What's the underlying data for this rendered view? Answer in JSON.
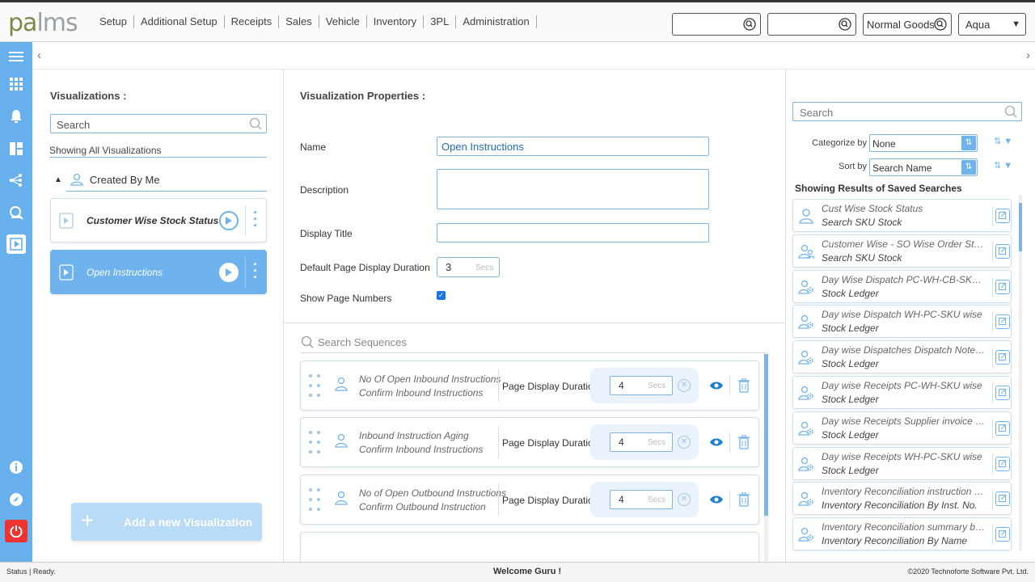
{
  "app": {
    "logo_a": "pa",
    "logo_b": "lms",
    "accent": "#67b0ec"
  },
  "nav": [
    "Setup",
    "Additional Setup",
    "Receipts",
    "Sales",
    "Vehicle",
    "Inventory",
    "3PL",
    "Administration"
  ],
  "top_search": {
    "box1": "",
    "box2": "",
    "box3": "Normal Goods",
    "theme": "Aqua"
  },
  "left": {
    "heading": "Visualizations :",
    "search_placeholder": "Search",
    "showing": "Showing All Visualizations",
    "group": "Created By Me",
    "items": [
      {
        "title": "Customer Wise Stock Status",
        "active": false
      },
      {
        "title": "Open Instructions",
        "active": true
      }
    ],
    "add_label": "Add a new Visualization"
  },
  "middle": {
    "heading": "Visualization Properties :",
    "name_label": "Name",
    "name_value": "Open Instructions",
    "description_label": "Description",
    "description_value": "",
    "display_title_label": "Display Title",
    "display_title_value": "",
    "default_duration_label": "Default Page Display Duration",
    "default_duration_value": "3",
    "secs": "Secs",
    "show_page_numbers_label": "Show Page Numbers",
    "show_page_numbers": true,
    "search_sequences_placeholder": "Search Sequences",
    "page_display_duration_label": "Page Display Duration:",
    "sequences": [
      {
        "line1": "No Of Open Inbound Instructions",
        "line2": "Confirm Inbound Instructions",
        "duration": "4"
      },
      {
        "line1": "Inbound Instruction Aging",
        "line2": "Confirm Inbound Instructions",
        "duration": "4"
      },
      {
        "line1": "No of Open Outbound Instructions",
        "line2": "Confirm Outbound Instruction",
        "duration": "4"
      }
    ]
  },
  "right": {
    "search_placeholder": "Search",
    "categorize_label": "Categorize by",
    "categorize_value": "None",
    "sort_label": "Sort by",
    "sort_value": "Search Name",
    "results_heading": "Showing Results of Saved Searches",
    "saved_searches": [
      {
        "a": "Cust Wise Stock Status",
        "b": "Search SKU Stock",
        "icon": "user-icon"
      },
      {
        "a": "Customer Wise - SO Wise Order Status",
        "b": "Search SKU Stock",
        "icon": "users-icon"
      },
      {
        "a": "Day Wise Dispatch PC-WH-CB-SKU wise",
        "b": "Stock Ledger",
        "icon": "user-gear-icon"
      },
      {
        "a": "Day wise Dispatch WH-PC-SKU wise",
        "b": "Stock Ledger",
        "icon": "user-gear-icon"
      },
      {
        "a": "Day wise Dispatches Dispatch Note numb...",
        "b": "Stock Ledger",
        "icon": "user-gear-icon"
      },
      {
        "a": "Day wise Receipts PC-WH-SKU wise",
        "b": "Stock Ledger",
        "icon": "user-gear-icon"
      },
      {
        "a": "Day wise Receipts Supplier invoice wise",
        "b": "Stock Ledger",
        "icon": "user-gear-icon"
      },
      {
        "a": "Day wise Receipts WH-PC-SKU wise",
        "b": "Stock Ledger",
        "icon": "user-gear-icon"
      },
      {
        "a": "Inventory Reconciliation instruction num...",
        "b": "Inventory Reconciliation By Inst. No.",
        "icon": "user-gear-icon"
      },
      {
        "a": "Inventory Reconciliation summary by Na...",
        "b": "Inventory Reconciliation By Name",
        "icon": "user-gear-icon"
      }
    ]
  },
  "status": {
    "left": "Status | Ready.",
    "center": "Welcome Guru !",
    "right": "©2020 Technoforte Software Pvt. Ltd."
  }
}
